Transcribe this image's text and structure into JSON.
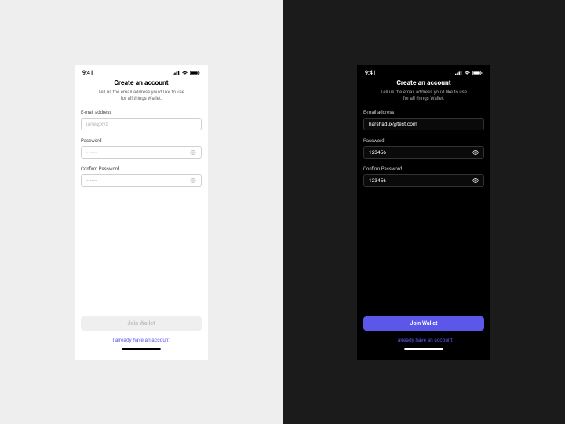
{
  "status": {
    "time": "9:41"
  },
  "heading": {
    "title": "Create an account",
    "subtitle_line1": "Tell us the email address you'd like to use",
    "subtitle_line2": "for all things Wallet."
  },
  "labels": {
    "email": "E-mail address",
    "password": "Password",
    "confirm": "Confirm Password"
  },
  "light": {
    "email_placeholder": "jane@xyz",
    "password_placeholder": "••••••",
    "confirm_placeholder": "••••••"
  },
  "dark": {
    "email_value": "harshadux@test.com",
    "password_value": "123456",
    "confirm_value": "123456"
  },
  "cta": {
    "join": "Join Wallet",
    "existing": "I already have an account"
  },
  "colors": {
    "accent": "#5b57e8"
  }
}
